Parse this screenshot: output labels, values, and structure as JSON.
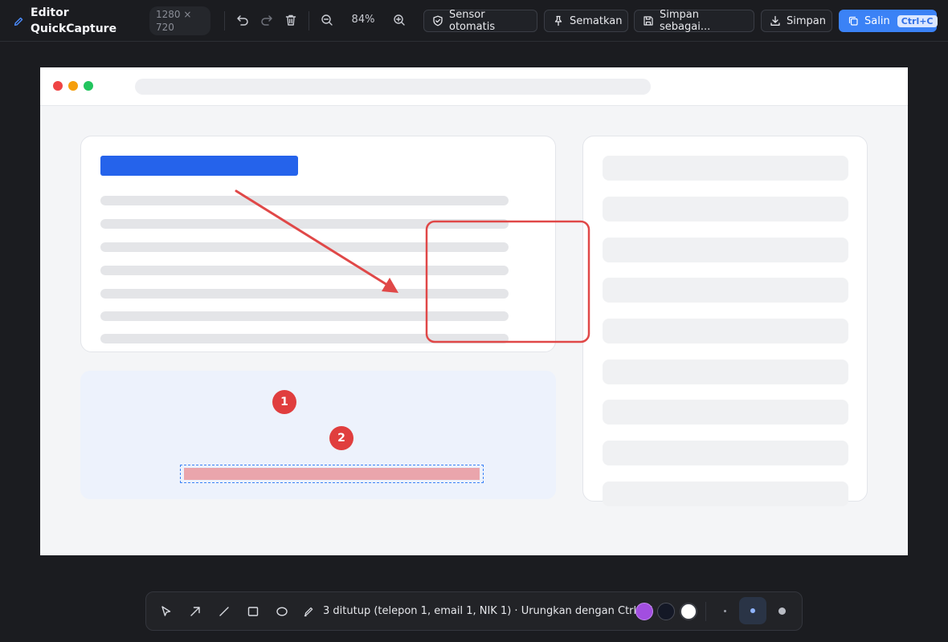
{
  "app": {
    "title": "Editor QuickCapture",
    "dimensions": "1280 × 720"
  },
  "toolbar": {
    "zoom": "84%",
    "auto_sensor_label": "Sensor otomatis",
    "pin_label": "Sematkan",
    "save_as_label": "Simpan sebagai...",
    "save_label": "Simpan",
    "copy_label": "Salin",
    "copy_shortcut": "Ctrl+C",
    "icons": [
      "pencil-icon",
      "undo-icon",
      "redo-icon",
      "trash-icon",
      "zoom-out-icon",
      "zoom-in-icon",
      "shield-icon",
      "pin-icon",
      "floppy-icon",
      "download-icon",
      "copy-icon"
    ]
  },
  "annotations": {
    "steps": [
      "1",
      "2"
    ],
    "colors": {
      "arrow": "#e04848",
      "rect": "#e04848",
      "step": "#e03e3e",
      "redaction": "#eaa5ac"
    }
  },
  "palette": {
    "tools": [
      "select-tool",
      "arrow-tool",
      "line-tool",
      "rectangle-tool",
      "ellipse-tool",
      "pen-tool"
    ],
    "status": "3 ditutup (telepon 1, email 1, NIK 1) · Urungkan dengan Ctrl+Z",
    "colors": [
      "#a24ee0",
      "#141826",
      "#ffffff"
    ],
    "sizes": [
      "small",
      "medium",
      "large"
    ],
    "active_size": "medium"
  },
  "theme": {
    "accent": "#3b82f6",
    "background": "#1b1c20"
  }
}
